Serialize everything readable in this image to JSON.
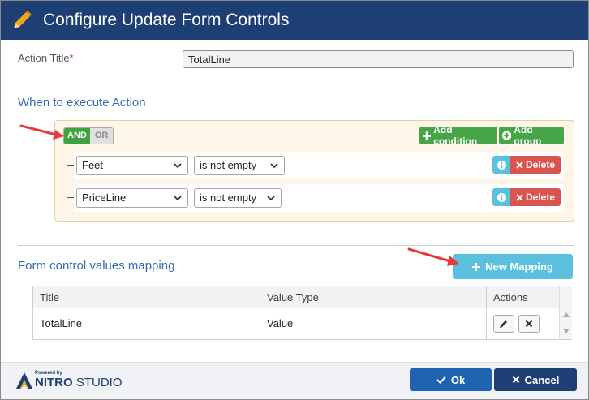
{
  "dialog": {
    "title": "Configure Update Form Controls",
    "title_icon": "pencil-icon",
    "brand_color": "#1e3f73"
  },
  "action_title": {
    "label": "Action Title",
    "required_mark": "*",
    "value": "TotalLine"
  },
  "conditions": {
    "section_title": "When to execute Action",
    "and_label": "AND",
    "or_label": "OR",
    "add_condition_label": "Add condition",
    "add_group_label": "Add group",
    "rules": [
      {
        "field": "Feet",
        "operator": "is not empty",
        "delete_label": "Delete"
      },
      {
        "field": "PriceLine",
        "operator": "is not empty",
        "delete_label": "Delete"
      }
    ]
  },
  "mapping": {
    "section_title": "Form control values mapping",
    "new_mapping_label": "New Mapping",
    "columns": [
      "Title",
      "Value Type",
      "Actions"
    ],
    "rows": [
      {
        "title": "TotalLine",
        "value_type": "Value"
      }
    ]
  },
  "footer": {
    "logo_powered": "Powered by",
    "logo_nitro": "NITRO",
    "logo_studio": "STUDIO",
    "ok_label": "Ok",
    "cancel_label": "Cancel"
  }
}
